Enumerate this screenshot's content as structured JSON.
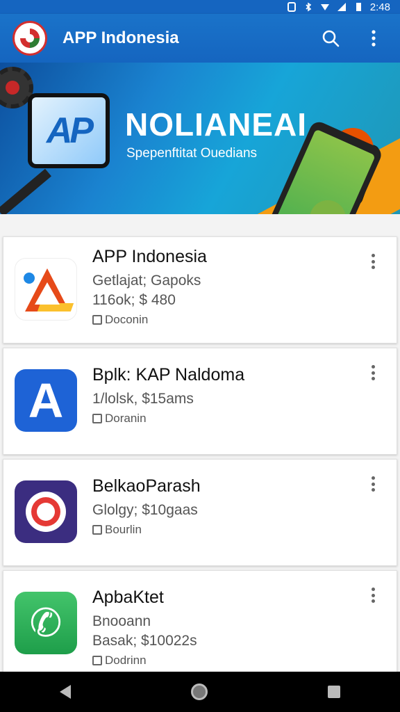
{
  "status_bar": {
    "time": "2:48"
  },
  "app_bar": {
    "title": "APP Indonesia"
  },
  "banner": {
    "title": "NOLIANEAI",
    "subtitle": "Spepenftitat Ouedians",
    "card_text": "AP"
  },
  "apps": [
    {
      "title": "APP Indonesia",
      "line1": "Getlajat; Gapoks",
      "line2": "116ok; $ 480",
      "developer": "Doconin",
      "icon": "triangle-app-icon"
    },
    {
      "title": "Bplk: KAP Naldoma",
      "line1": "1/lolsk, $15ams",
      "line2": "",
      "developer": "Doranin",
      "icon": "letter-a-app-icon"
    },
    {
      "title": "BelkaoParash",
      "line1": "Glolgy; $10gaas",
      "line2": "",
      "developer": "Bourlin",
      "icon": "ring-app-icon"
    },
    {
      "title": "ApbaKtet",
      "line1": "Bnooann",
      "line2": "Basak; $10022s",
      "developer": "Dodrinn",
      "icon": "phone-app-icon"
    }
  ],
  "colors": {
    "primary": "#1565c0",
    "accent": "#f39c12"
  }
}
